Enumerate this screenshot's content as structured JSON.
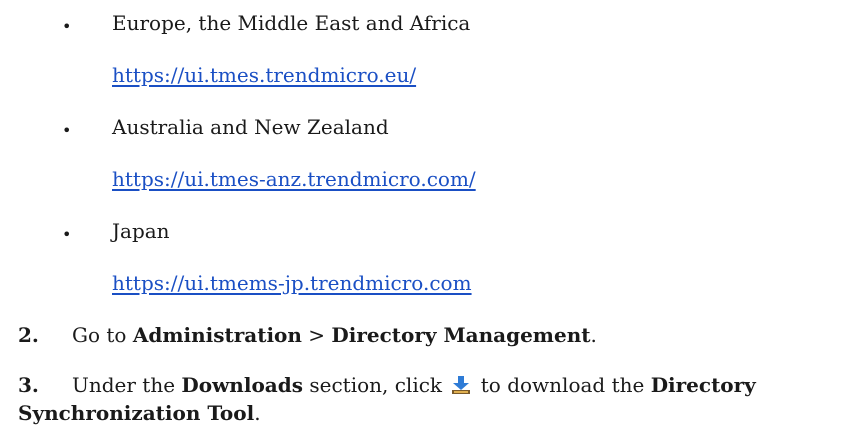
{
  "regions": [
    {
      "name": "Europe, the Middle East and Africa",
      "url": "https://ui.tmes.trendmicro.eu/"
    },
    {
      "name": "Australia and New Zealand",
      "url": "https://ui.tmes-anz.trendmicro.com/"
    },
    {
      "name": "Japan",
      "url": "https://ui.tmems-jp.trendmicro.com"
    }
  ],
  "bullet_glyph": "•",
  "steps": {
    "step2": {
      "number": "2.",
      "text_before": "Go to ",
      "bold1": "Administration",
      "separator": " > ",
      "bold2": "Directory Management",
      "text_after": "."
    },
    "step3": {
      "number": "3.",
      "text_before": "Under the ",
      "bold1": "Downloads",
      "text_mid": " section, click ",
      "icon": "download-icon",
      "text_mid2": " to download the ",
      "bold2_line1": "Directory",
      "bold2_line2": "Synchronization Tool",
      "text_after": "."
    }
  }
}
